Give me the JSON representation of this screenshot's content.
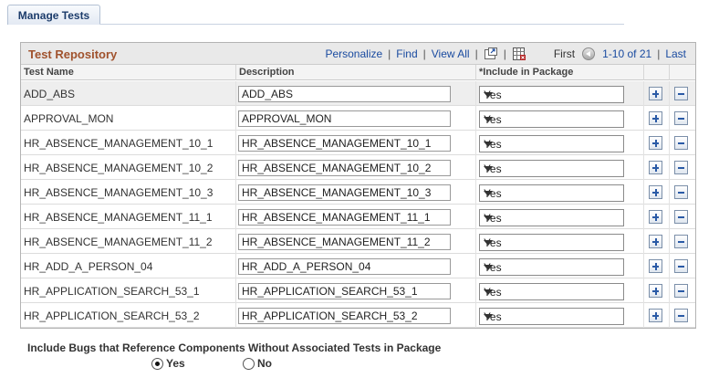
{
  "tab": {
    "label": "Manage Tests"
  },
  "grid": {
    "title": "Test Repository",
    "nav": {
      "personalize": "Personalize",
      "find": "Find",
      "view_all": "View All",
      "first": "First",
      "range": "1-10 of 21",
      "last": "Last"
    },
    "columns": {
      "name": "Test Name",
      "description": "Description",
      "include": "*Include in Package"
    },
    "rows": [
      {
        "name": "ADD_ABS",
        "description": "ADD_ABS",
        "include": "Yes"
      },
      {
        "name": "APPROVAL_MON",
        "description": "APPROVAL_MON",
        "include": "Yes"
      },
      {
        "name": "HR_ABSENCE_MANAGEMENT_10_1",
        "description": "HR_ABSENCE_MANAGEMENT_10_1",
        "include": "Yes"
      },
      {
        "name": "HR_ABSENCE_MANAGEMENT_10_2",
        "description": "HR_ABSENCE_MANAGEMENT_10_2",
        "include": "Yes"
      },
      {
        "name": "HR_ABSENCE_MANAGEMENT_10_3",
        "description": "HR_ABSENCE_MANAGEMENT_10_3",
        "include": "Yes"
      },
      {
        "name": "HR_ABSENCE_MANAGEMENT_11_1",
        "description": "HR_ABSENCE_MANAGEMENT_11_1",
        "include": "Yes"
      },
      {
        "name": "HR_ABSENCE_MANAGEMENT_11_2",
        "description": "HR_ABSENCE_MANAGEMENT_11_2",
        "include": "Yes"
      },
      {
        "name": "HR_ADD_A_PERSON_04",
        "description": "HR_ADD_A_PERSON_04",
        "include": "Yes"
      },
      {
        "name": "HR_APPLICATION_SEARCH_53_1",
        "description": "HR_APPLICATION_SEARCH_53_1",
        "include": "Yes"
      },
      {
        "name": "HR_APPLICATION_SEARCH_53_2",
        "description": "HR_APPLICATION_SEARCH_53_2",
        "include": "Yes"
      }
    ]
  },
  "bugs": {
    "label": "Include Bugs that Reference Components Without Associated Tests in Package",
    "options": [
      {
        "label": "Yes",
        "selected": true
      },
      {
        "label": "No",
        "selected": false
      }
    ]
  },
  "icons": {
    "zoom": "zoom-grid-icon",
    "download": "download-excel-icon",
    "prev": "previous-arrow-icon",
    "add": "add-row-icon",
    "delete": "delete-row-icon"
  },
  "colors": {
    "title": "#a0522d",
    "link": "#1a4ba0",
    "tab_text": "#1c3c6b"
  }
}
